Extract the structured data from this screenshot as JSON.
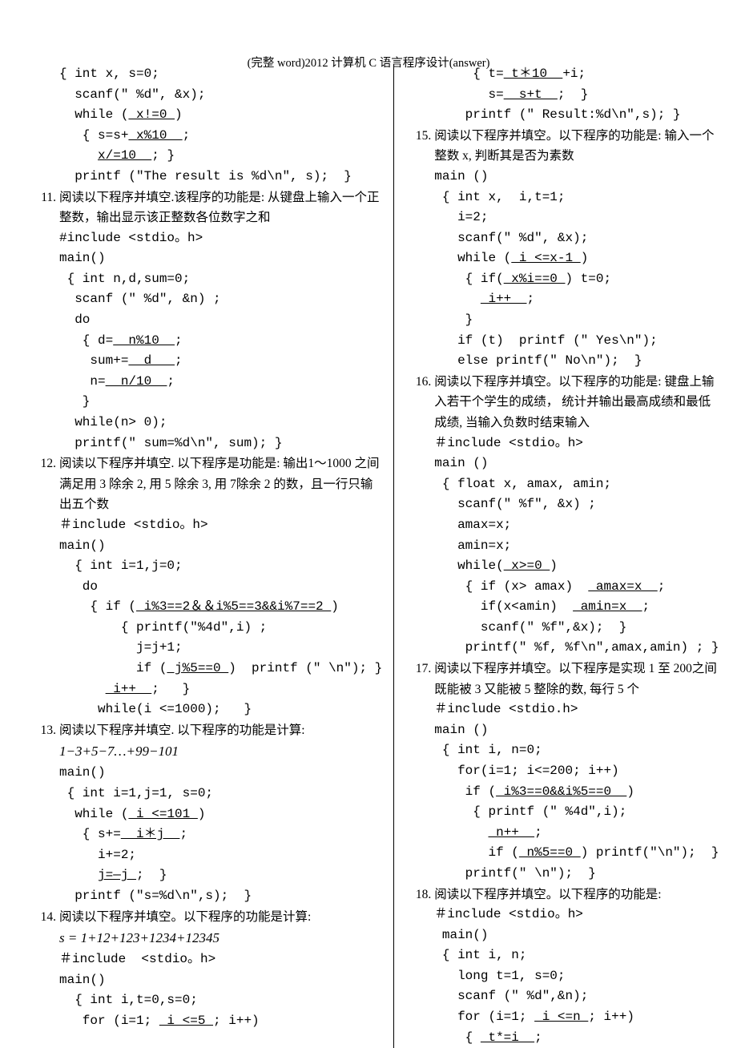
{
  "header": "(完整 word)2012 计算机 C 语言程序设计(answer)",
  "left": {
    "code10": {
      "l1": "{ int x, s=0;",
      "l2": "  scanf(\" %d\", &x);",
      "l3": "  while (",
      "b1": " x!=0 ",
      "l3b": ")",
      "l4": "   { s=s+",
      "b2": " x%10  ",
      "l4b": ";",
      "l5": "     ",
      "b3": "x/=10  ",
      "l5b": "; }",
      "l6": "  printf (\"The result is %d\\n\", s);  }"
    },
    "q11": {
      "num": "11.",
      "desc": "阅读以下程序并填空.该程序的功能是: 从键盘上输入一个正整数，输出显示该正整数各位数字之和",
      "c1": "#include <stdio。h>",
      "c2": "main()",
      "c3": " { int n,d,sum=0;",
      "c4": "  scanf (\" %d\", &n) ;",
      "c5": "  do",
      "c6": "   { d=",
      "b1": "  n%10  ",
      "c6b": ";",
      "c7": "    sum+=",
      "b2": "  d   ",
      "c7b": ";",
      "c8": "    n=",
      "b3": "  n/10  ",
      "c8b": ";",
      "c9": "   }",
      "c10": "  while(n> 0);",
      "c11": "  printf(\" sum=%d\\n\", sum); }"
    },
    "q12": {
      "num": "12.",
      "desc": "阅读以下程序并填空. 以下程序是功能是: 输出1～1000 之间满足用 3 除余 2, 用 5 除余 3, 用 7除余 2 的数，且一行只输出五个数",
      "c1": "＃include <stdio。h>",
      "c2": "main()",
      "c3": "  { int i=1,j=0;",
      "c4": "   do",
      "c5": "    { if (",
      "b1": " i%3==2＆＆i%5==3&&i%7==2 ",
      "c5b": ")",
      "c6": "        { printf(\"%4d\",i) ;",
      "c7": "          j=j+1;",
      "c8": "          if (",
      "b2": " j%5==0 ",
      "c8b": ")  printf (\" \\n\"); }",
      "c9": "      ",
      "b3": " i++  ",
      "c9b": ";   }",
      "c10": "     while(i <=1000);   }"
    },
    "q13": {
      "num": "13.",
      "desc": "阅读以下程序并填空. 以下程序的功能是计算:",
      "formula": "1−3+5−7…+99−101",
      "c1": "main()",
      "c2": " { int i=1,j=1, s=0;",
      "c3": "  while (",
      "b1": " i <=101 ",
      "c3b": ")",
      "c4": "   { s+=",
      "b2": "  i＊j  ",
      "c4b": ";",
      "c5": "     i+=2;",
      "c6": "     ",
      "b3": "j=—j ",
      "c6b": ";  }",
      "c7": "  printf (\"s=%d\\n\",s);  }"
    },
    "q14": {
      "num": "14.",
      "desc": "阅读以下程序并填空。以下程序的功能是计算:",
      "formula": "s = 1+12+123+1234+12345",
      "c1": "＃include  <stdio。h>",
      "c2": "main()",
      "c3": "  { int i,t=0,s=0;",
      "c4": "   for (i=1; ",
      "b1": " i <=5 ",
      "c4b": "; i++)"
    }
  },
  "right": {
    "code14b": {
      "l1": "     { t=",
      "b1": " t＊10  ",
      "l1b": "+i;",
      "l2": "       s=",
      "b2": "  s+t  ",
      "l2b": ";  }",
      "l3": "    printf (\" Result:%d\\n\",s); }"
    },
    "q15": {
      "num": "15.",
      "desc": "阅读以下程序并填空。以下程序的功能是: 输入一个整数 x, 判断其是否为素数",
      "c1": "main ()",
      "c2": " { int x,  i,t=1;",
      "c3": "   i=2;",
      "c4": "   scanf(\" %d\", &x);",
      "c5": "   while (",
      "b1": " i <=x-1 ",
      "c5b": ")",
      "c6": "    { if(",
      "b2": " x%i==0 ",
      "c6b": ") t=0;",
      "c7": "      ",
      "b3": " i++  ",
      "c7b": ";",
      "c8": "    }",
      "c9": "   if (t)  printf (\" Yes\\n\");",
      "c10": "   else printf(\" No\\n\");  }"
    },
    "q16": {
      "num": "16.",
      "desc": "阅读以下程序并填空。以下程序的功能是: 键盘上输入若干个学生的成绩， 统计并输出最高成绩和最低成绩, 当输入负数时结束输入",
      "c1": "＃include <stdio。h>",
      "c2": "main ()",
      "c3": " { float x, amax, amin;",
      "c4": "   scanf(\" %f\", &x) ;",
      "c5": "   amax=x;",
      "c6": "   amin=x;",
      "c7": "   while(",
      "b1": " x>=0 ",
      "c7b": ")",
      "c8": "    { if (x> amax)  ",
      "b2": " amax=x  ",
      "c8b": ";",
      "c9": "      if(x<amin)  ",
      "b3": " amin=x  ",
      "c9b": ";",
      "c10": "      scanf(\" %f\",&x);  }",
      "c11": "    printf(\" %f, %f\\n\",amax,amin) ; }"
    },
    "q17": {
      "num": "17.",
      "desc": "阅读以下程序并填空。以下程序是实现 1 至 200之间既能被 3 又能被 5 整除的数, 每行 5 个",
      "c1": "＃include <stdio.h>",
      "c2": "main ()",
      "c3": " { int i, n=0;",
      "c4": "   for(i=1; i<=200; i++)",
      "c5": "    if (",
      "b1": " i%3==0&&i%5==0  ",
      "c5b": ")",
      "c6": "     { printf (\" %4d\",i);",
      "c7": "       ",
      "b2": " n++  ",
      "c7b": ";",
      "c8": "       if (",
      "b3": " n%5==0 ",
      "c8b": ") printf(\"\\n\");  }",
      "c9": "    printf(\" \\n\");  }"
    },
    "q18": {
      "num": "18.",
      "desc": "阅读以下程序并填空。以下程序的功能是:",
      "c1": "＃include <stdio。h>",
      "c2": " main()",
      "c3": " { int i, n;",
      "c4": "   long t=1, s=0;",
      "c5": "   scanf (\" %d\",&n);",
      "c6": "   for (i=1; ",
      "b1": " i <=n ",
      "c6b": "; i++)",
      "c7": "    { ",
      "b2": " t*=i  ",
      "c7b": ";"
    }
  }
}
